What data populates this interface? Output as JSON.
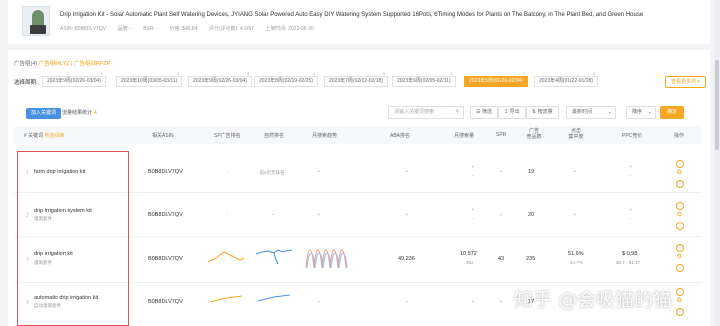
{
  "product": {
    "title": "Drip Irrigation Kit - Solar Automatic Plant Self Watering Devices, JYIANG Solar Powered Auto Easy DIY Watering System Supported 16Pots, 6Timing Modes for Plants on The Balcony, in The Plant Bed, and Green House",
    "meta": [
      "ASIN: B0B8DLV7QV",
      "品牌: -",
      "BSR: -",
      "价格: $45.84",
      "评分(评论数): 4.6/67",
      "上架时间: 2022-08-30"
    ]
  },
  "groups": {
    "prefix": "广告组(4)",
    "text": "广告组MLYZ | 广告组动RFZP"
  },
  "periods": {
    "label": "选择周期:",
    "items": [
      {
        "label": "2023年9周(02/26-03/04)",
        "badge": "1"
      },
      {
        "label": "2023年10周(03/05-03/11)",
        "badge": "2"
      },
      {
        "label": "2023年9周(02/26-03/04)",
        "badge": "3"
      },
      {
        "label": "2023年8周(02/19-02/25)",
        "badge": "4"
      },
      {
        "label": "2023年7周(02/12-02/18)",
        "badge": "5"
      },
      {
        "label": "2023年6周(02/05-02/11)",
        "badge": "6"
      },
      {
        "label": "2023年5周(01/29-02/04)",
        "badge": "7"
      },
      {
        "label": "2023年4周(01/22-01/28)",
        "badge": "8"
      }
    ],
    "more_label": "查看更多周 ▾"
  },
  "toolbar": {
    "add_label": "加入关键词",
    "extra_label": "流量结果统计",
    "extra_count": "4",
    "search_placeholder": "请输入关键词搜索",
    "filter_label": "筛选",
    "export_label": "导出",
    "sort_label": "按流量",
    "date_label": "最新时间",
    "mode_label": "降序",
    "confirm_label": "确定"
  },
  "table": {
    "headers": [
      "# 关键词",
      "相关ASIN",
      "SP广告排名",
      "自然排名",
      "月搜索趋势",
      "ABA排名",
      "月搜索量",
      "SPR",
      "广告\n竞品数",
      "点击\n集中度",
      "PPC竞价",
      "操作"
    ],
    "rows": [
      {
        "idx": "1",
        "kw": "farm drip irrigation kit",
        "sub": "",
        "asin": "B0B8DLV7QV",
        "organic": "-前2页无排名",
        "aba": "-",
        "vol": "-",
        "vol_sub": "-",
        "spr": "-",
        "ads": "19",
        "click": "-",
        "click_sub": "-",
        "ppc": "-",
        "ppc_sub": ""
      },
      {
        "idx": "2",
        "kw": "drip irrigation system kit",
        "sub": "灌溉套件",
        "asin": "B0B8DLV7QV",
        "organic": "-",
        "aba": "-",
        "vol": "-",
        "vol_sub": "-",
        "spr": "-",
        "ads": "20",
        "click": "-",
        "click_sub": "-",
        "ppc": "-",
        "ppc_sub": "-"
      },
      {
        "idx": "3",
        "kw": "drip irrigation kit",
        "sub": "灌溉套件",
        "asin": "B0B8DLV7QV",
        "organic": "",
        "aba": "49,236",
        "vol": "10,572",
        "vol_sub": "382",
        "spr": "43",
        "ads": "235",
        "click": "51.6%",
        "click_sub": "44.7%",
        "ppc": "$ 0.98",
        "ppc_sub": "$0.7 - $1.17"
      },
      {
        "idx": "4",
        "kw": "automatic drip irrigation kit",
        "sub": "自动灌溉套件",
        "asin": "B0B8DLV7QV",
        "organic": "",
        "aba": "-",
        "vol": "-",
        "vol_sub": "",
        "spr": "-",
        "ads": "17",
        "click": "",
        "click_sub": "",
        "ppc": "-",
        "ppc_sub": ""
      }
    ]
  },
  "watermark": "知乎 @会吸猫的猫",
  "colors": {
    "accent": "#f5a623",
    "primary": "#4a90e2",
    "highlight": "#e05353",
    "trend_a": "#f5a623",
    "trend_b": "#4a90e2"
  }
}
